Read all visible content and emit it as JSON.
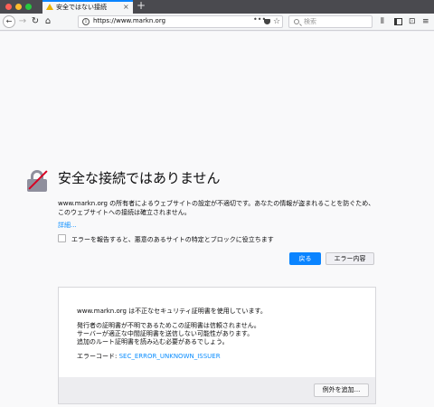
{
  "tab": {
    "title": "安全ではない接続",
    "close_glyph": "×",
    "new_tab_glyph": "+"
  },
  "toolbar": {
    "back_glyph": "←",
    "forward_glyph": "→",
    "reload_glyph": "↻",
    "home_glyph": "⌂",
    "url": "https://www.markn.org",
    "page_actions_glyph": "•••",
    "bookmark_glyph": "☆",
    "search_placeholder": "検索",
    "library_glyph": "⫴",
    "sync_glyph": "⊡",
    "menu_glyph": "≡"
  },
  "error": {
    "title": "安全な接続ではありません",
    "description": "www.markn.org の所有者によるウェブサイトの設定が不適切です。あなたの情報が盗まれることを防ぐため、このウェブサイトへの接続は確立されません。",
    "advanced_link": "詳細...",
    "report_label": "エラーを報告すると、悪意のあるサイトの特定とブロックに役立ちます",
    "back_button": "戻る",
    "advanced_button": "エラー内容"
  },
  "details": {
    "line1": "www.markn.org は不正なセキュリティ証明書を使用しています。",
    "line2": "発行者の証明書が不明であるためこの証明書は信頼されません。",
    "line3": "サーバーが適正な中間証明書を送信しない可能性があります。",
    "line4": "追加のルート証明書を読み込む必要があるでしょう。",
    "code_label": "エラーコード: ",
    "code_value": "SEC_ERROR_UNKNOWN_ISSUER",
    "exception_button": "例外を追加..."
  },
  "colors": {
    "accent": "#0a84ff",
    "link": "#0a8dff",
    "warning": "#e8b100",
    "lock_slash": "#d70022"
  },
  "icons": [
    "warning-icon",
    "back-arrow-icon",
    "forward-arrow-icon",
    "reload-icon",
    "home-icon",
    "info-icon",
    "pocket-icon",
    "star-icon",
    "search-icon",
    "library-icon",
    "sidebar-icon",
    "sync-icon",
    "hamburger-menu-icon",
    "broken-lock-icon"
  ]
}
